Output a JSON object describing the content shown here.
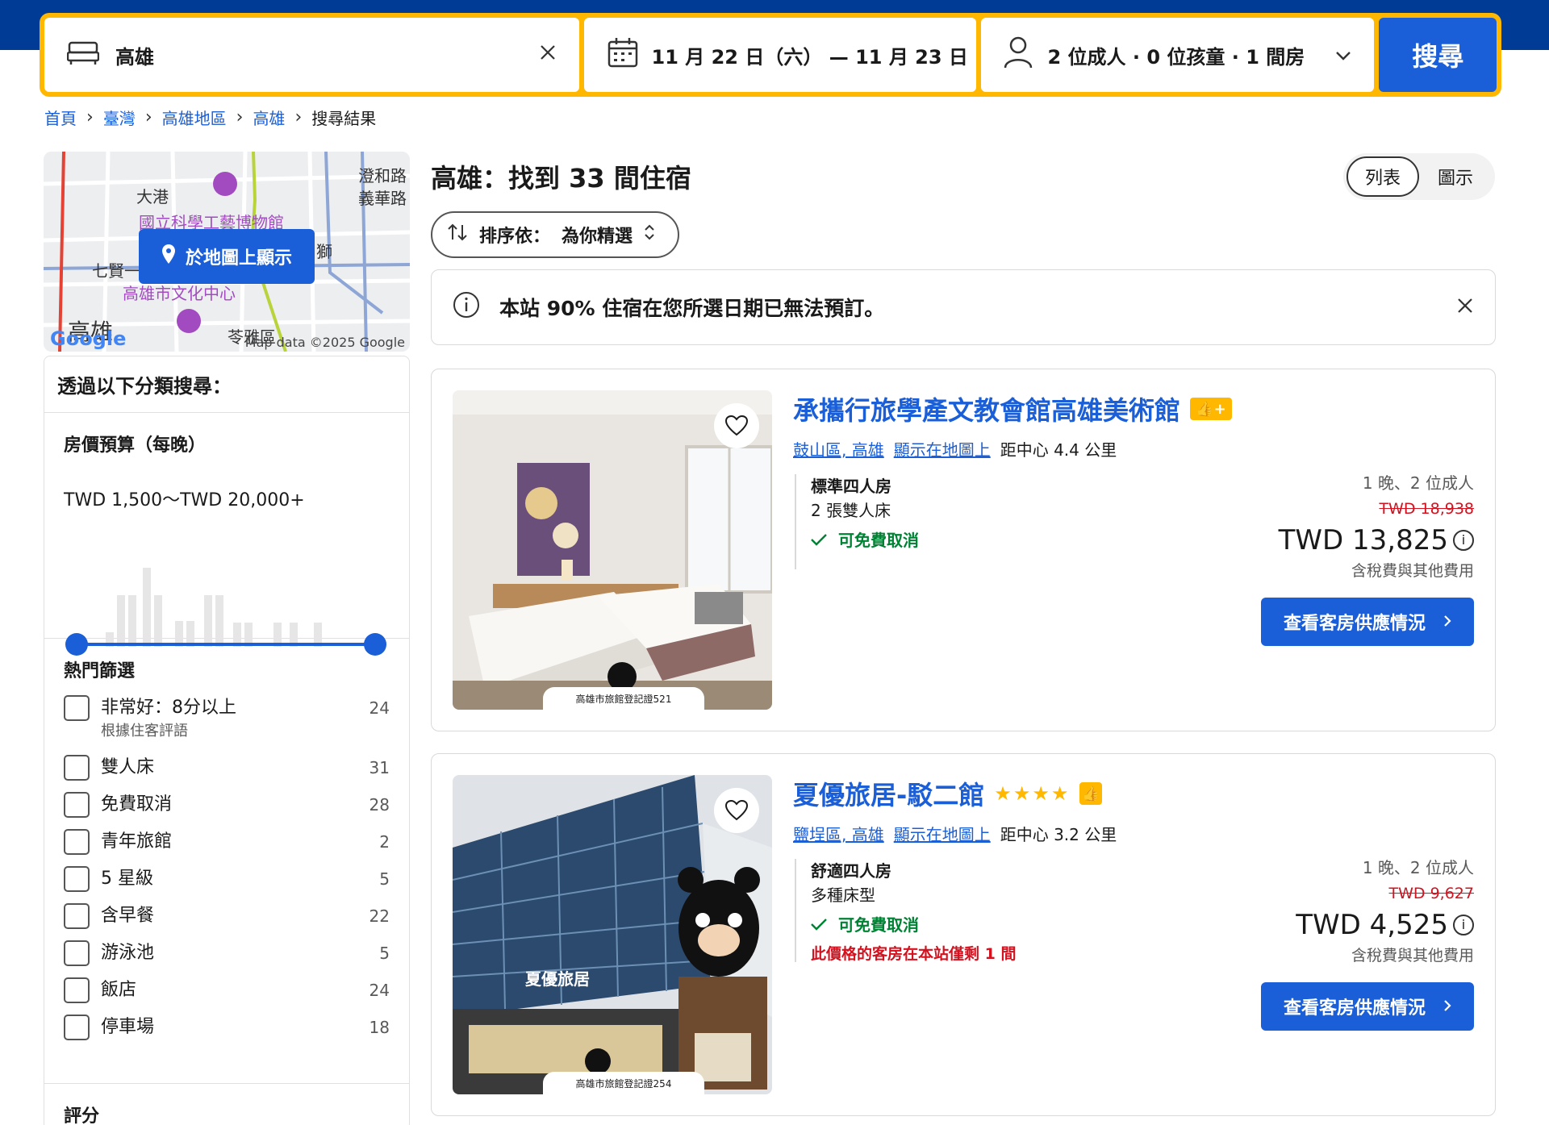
{
  "search": {
    "destination": "高雄",
    "dates": "11 月 22 日（六） — 11 月 23 日（日）",
    "occupancy": "2 位成人 · 0 位孩童 · 1 間房",
    "button": "搜尋"
  },
  "breadcrumb": [
    "首頁",
    "臺灣",
    "高雄地區",
    "高雄",
    "搜尋結果"
  ],
  "map": {
    "button": "於地圖上顯示",
    "labels": [
      "澄和路",
      "義華路",
      "大港",
      "國立科學工藝博物館",
      "七賢一路",
      "高雄市文化中心",
      "高雄",
      "苓雅區",
      "獅"
    ],
    "copyright": "Map data ©2025 Google",
    "logo": "Google"
  },
  "filters": {
    "heading": "透過以下分類搜尋：",
    "budget": {
      "title": "房價預算（每晚）",
      "range": "TWD 1,500～TWD 20,000+"
    },
    "popular": {
      "title": "熱門篩選",
      "items": [
        {
          "label": "非常好：8分以上",
          "sub": "根據住客評語",
          "count": "24"
        },
        {
          "label": "雙人床",
          "sub": "",
          "count": "31"
        },
        {
          "label": "免費取消",
          "sub": "",
          "count": "28"
        },
        {
          "label": "青年旅館",
          "sub": "",
          "count": "2"
        },
        {
          "label": "5 星級",
          "sub": "",
          "count": "5"
        },
        {
          "label": "含早餐",
          "sub": "",
          "count": "22"
        },
        {
          "label": "游泳池",
          "sub": "",
          "count": "5"
        },
        {
          "label": "飯店",
          "sub": "",
          "count": "24"
        },
        {
          "label": "停車場",
          "sub": "",
          "count": "18"
        }
      ]
    },
    "rating_title": "評分"
  },
  "results": {
    "title": "高雄：找到 33 間住宿",
    "view_list": "列表",
    "view_map": "圖示",
    "sort_label": "排序依：",
    "sort_value": "為你精選",
    "alert": "本站 90% 住宿在您所選日期已無法預訂。"
  },
  "hotels": [
    {
      "name": "承攜行旅學產文教會館高雄美術館",
      "stars": "",
      "district": "鼓山區, 高雄",
      "map_link": "顯示在地圖上",
      "distance": "距中心 4.4 公里",
      "room": "標準四人房",
      "bed": "2 張雙人床",
      "cancel": "可免費取消",
      "scarcity": "",
      "stay": "1 晚、2 位成人",
      "orig_price": "TWD 18,938",
      "price": "TWD 13,825",
      "tax": "含稅費與其他費用",
      "cta": "查看客房供應情況",
      "reg_badge": "高雄市旅館登記證521"
    },
    {
      "name": "夏優旅居-駁二館",
      "stars": "★★★★",
      "district": "鹽埕區, 高雄",
      "map_link": "顯示在地圖上",
      "distance": "距中心 3.2 公里",
      "room": "舒適四人房",
      "bed": "多種床型",
      "cancel": "可免費取消",
      "scarcity": "此價格的客房在本站僅剩 1 間",
      "stay": "1 晚、2 位成人",
      "orig_price": "TWD 9,627",
      "price": "TWD 4,525",
      "tax": "含稅費與其他費用",
      "cta": "查看客房供應情況",
      "reg_badge": "高雄市旅館登記證254",
      "sign": "夏優旅居"
    }
  ]
}
